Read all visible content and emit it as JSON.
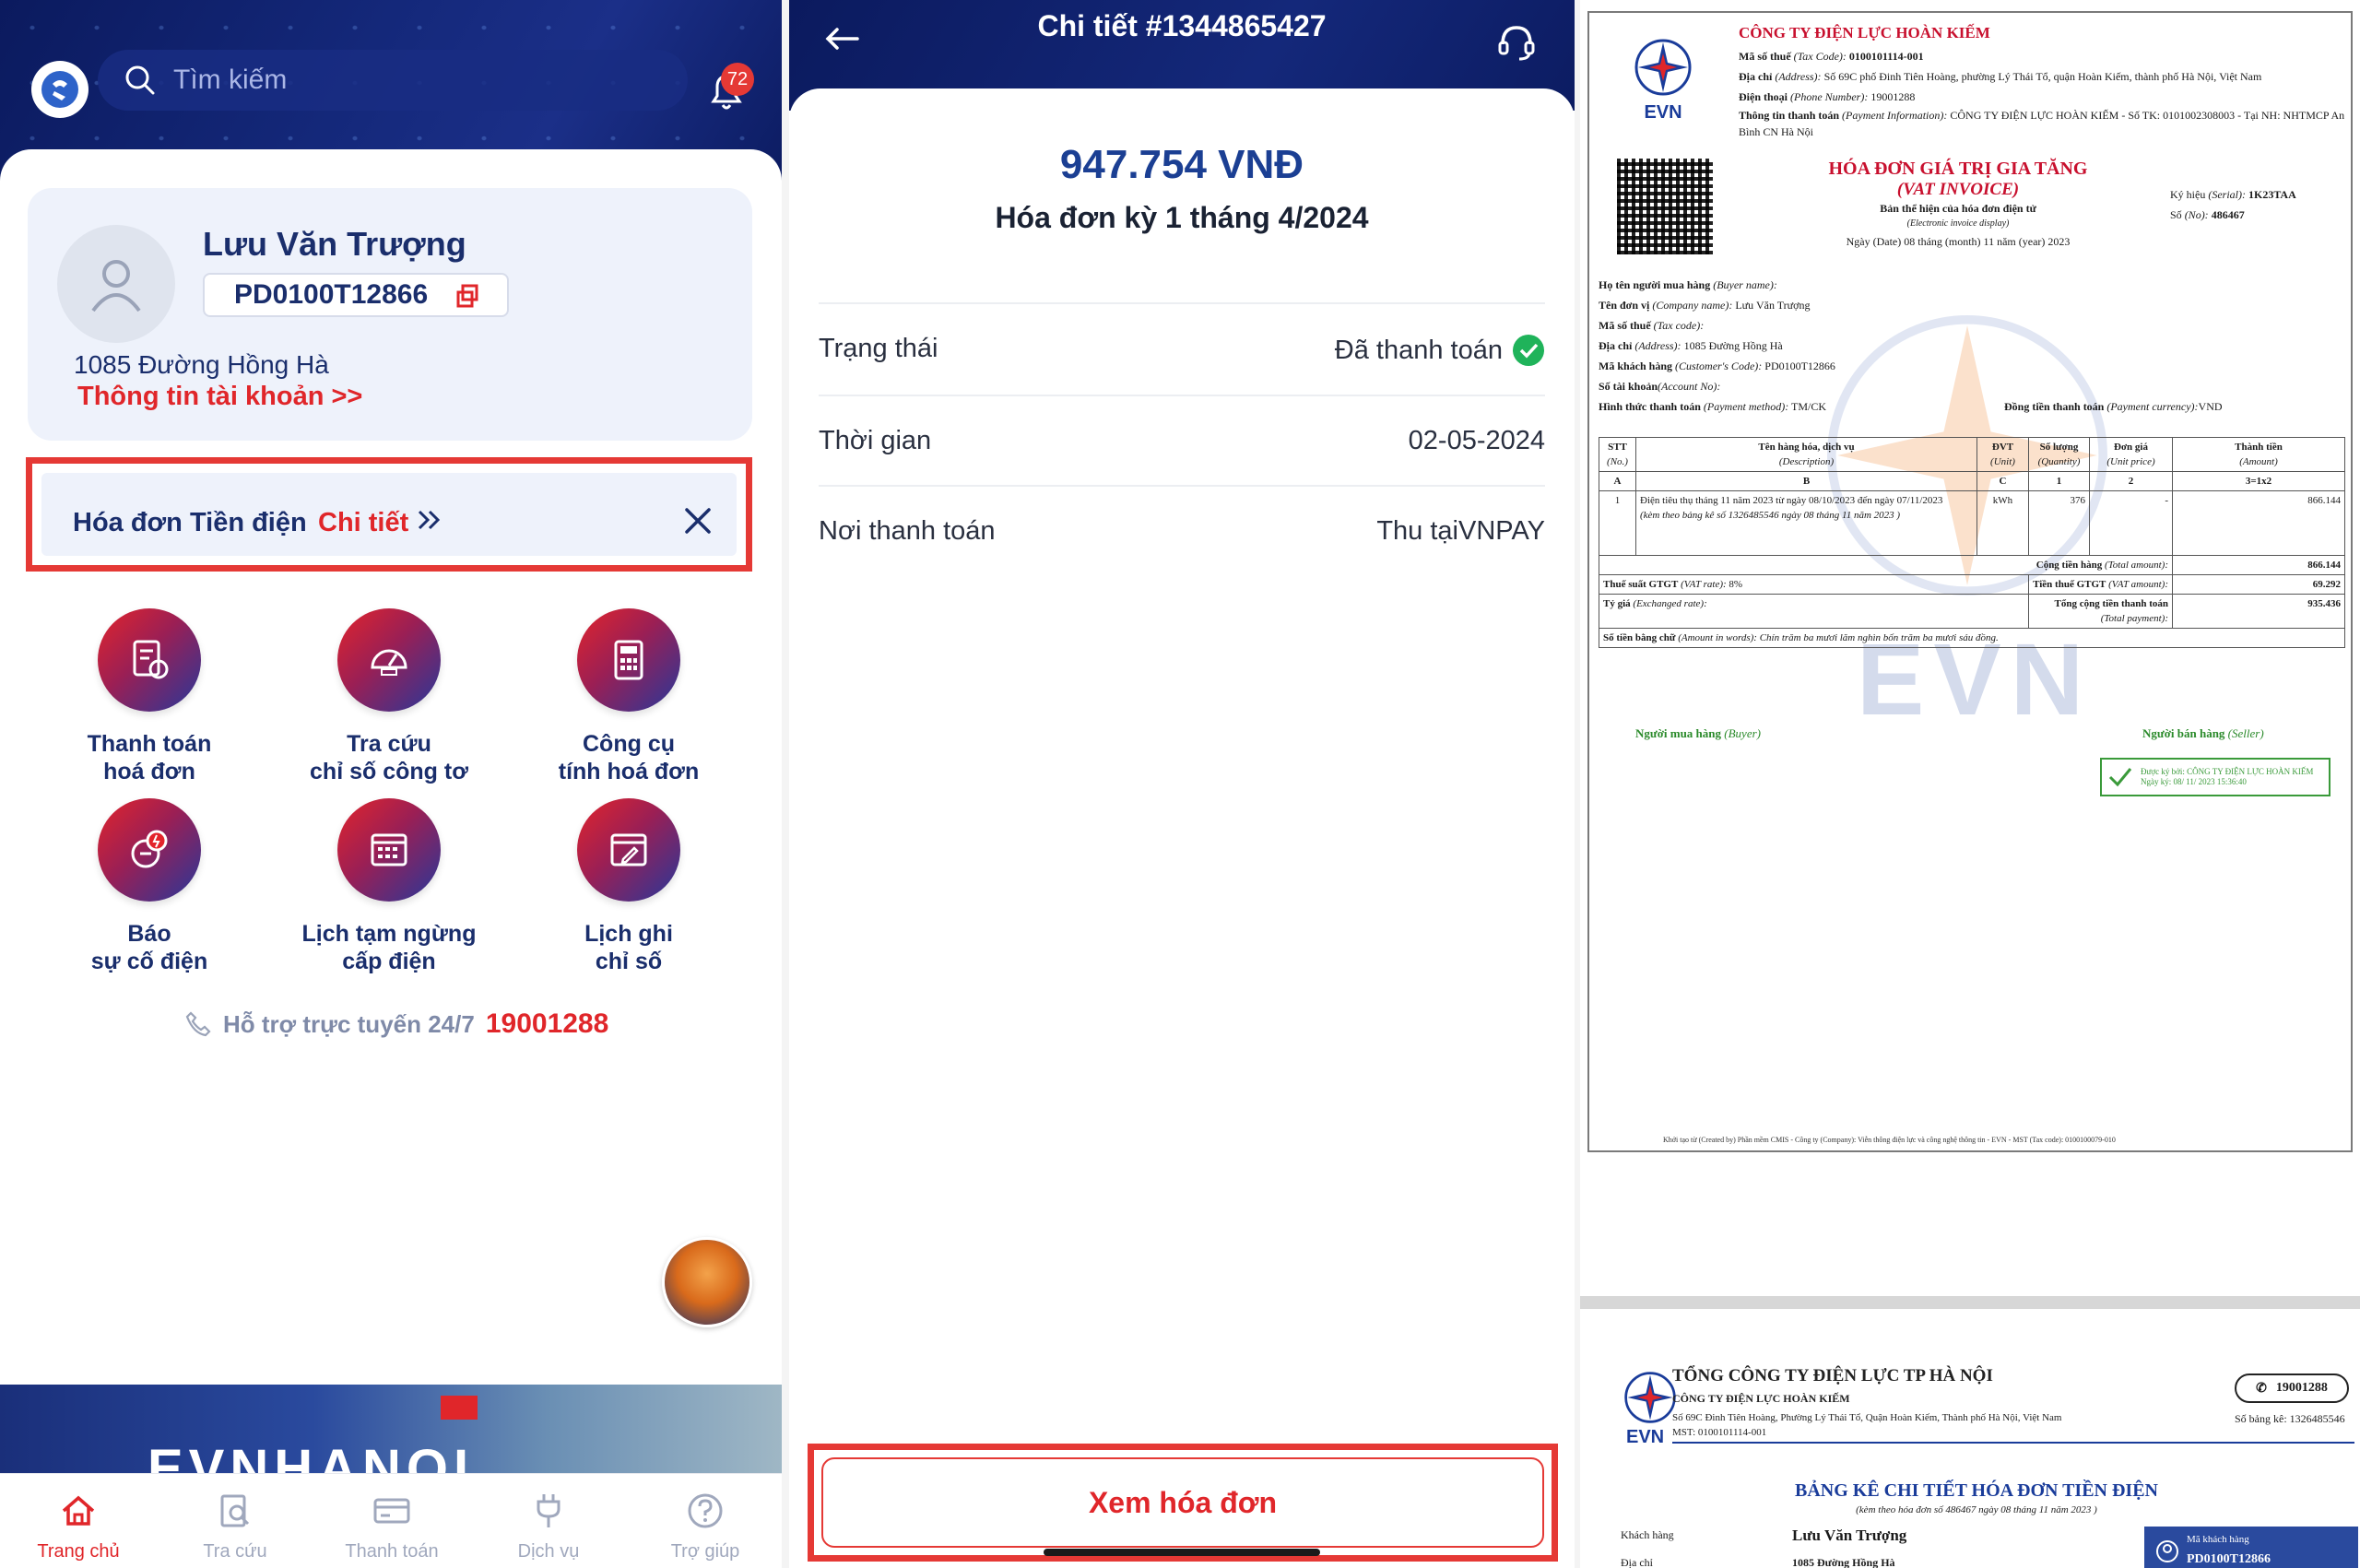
{
  "panel1": {
    "search_placeholder": "Tìm kiếm",
    "notif_count": "72",
    "account": {
      "name": "Lưu Văn Trượng",
      "customer_code": "PD0100T12866",
      "address": "1085 Đường Hồng Hà",
      "info_link": "Thông tin tài khoản >>"
    },
    "bill_banner": {
      "title": "Hóa đơn Tiền điện",
      "link": "Chi tiết"
    },
    "services": [
      {
        "line1": "Thanh toán",
        "line2": "hoá đơn",
        "icon": "invoice-pay-icon"
      },
      {
        "line1": "Tra cứu",
        "line2": "chỉ số công tơ",
        "icon": "meter-icon"
      },
      {
        "line1": "Công cụ",
        "line2": "tính hoá đơn",
        "icon": "calculator-icon"
      },
      {
        "line1": "Báo",
        "line2": "sự cố điện",
        "icon": "report-icon"
      },
      {
        "line1": "Lịch tạm ngừng",
        "line2": "cấp điện",
        "icon": "calendar-icon"
      },
      {
        "line1": "Lịch ghi",
        "line2": "chỉ số",
        "icon": "schedule-icon"
      }
    ],
    "hotline_label": "Hỗ trợ trực tuyến 24/7",
    "hotline_number": "19001288",
    "banner_text": "EVNHANOI",
    "tabs": [
      {
        "label": "Trang chủ",
        "icon": "home-icon"
      },
      {
        "label": "Tra cứu",
        "icon": "search-doc-icon"
      },
      {
        "label": "Thanh toán",
        "icon": "card-icon"
      },
      {
        "label": "Dịch vụ",
        "icon": "plug-icon"
      },
      {
        "label": "Trợ giúp",
        "icon": "help-icon"
      }
    ]
  },
  "panel2": {
    "title": "Chi tiết #1344865427",
    "amount": "947.754 VNĐ",
    "period": "Hóa đơn kỳ 1 tháng 4/2024",
    "rows": [
      {
        "key": "Trạng thái",
        "value": "Đã thanh toán"
      },
      {
        "key": "Thời gian",
        "value": "02-05-2024"
      },
      {
        "key": "Nơi thanh toán",
        "value": "Thu tạiVNPAY"
      }
    ],
    "button": "Xem hóa đơn"
  },
  "invoice": {
    "company": "CÔNG TY ĐIỆN LỰC HOÀN KIẾM",
    "tax_label": "Mã số thuế",
    "tax_label_en": "(Tax Code):",
    "tax_code": "0100101114-001",
    "address_label": "Địa chỉ",
    "address_label_en": "(Address):",
    "address": "Số 69C phố Đinh Tiên Hoàng, phường Lý Thái Tổ, quận Hoàn Kiếm, thành phố Hà Nội, Việt Nam",
    "phone_label": "Điện thoại",
    "phone_label_en": "(Phone Number):",
    "phone": "19001288",
    "payinfo_label": "Thông tin thanh toán",
    "payinfo_label_en": "(Payment Information):",
    "payinfo": "CÔNG TY ĐIỆN LỰC HOÀN KIẾM - Số TK: 0101002308003 - Tại NH: NHTMCP An Bình CN Hà Nội",
    "logo_text": "EVN",
    "title_vi": "HÓA ĐƠN GIÁ TRỊ GIA TĂNG",
    "title_en": "(VAT INVOICE)",
    "subtitle": "Bản thể hiện của hóa đơn điện tử",
    "subtitle_en": "(Electronic invoice display)",
    "date_line": "Ngày (Date) 08 tháng (month) 11 năm (year) 2023",
    "serial_label": "Ký hiệu",
    "serial_label_en": "(Serial):",
    "serial": "1K23TAA",
    "no_label": "Số",
    "no_label_en": "(No):",
    "no": "486467",
    "buyer": [
      {
        "k": "Họ tên người mua hàng",
        "ken": "(Buyer name):",
        "v": ""
      },
      {
        "k": "Tên đơn vị",
        "ken": "(Company name):",
        "v": "Lưu Văn Trượng"
      },
      {
        "k": "Mã số thuế",
        "ken": "(Tax code):",
        "v": ""
      },
      {
        "k": "Địa chỉ",
        "ken": "(Address):",
        "v": "1085 Đường Hồng Hà"
      },
      {
        "k": "Mã khách hàng",
        "ken": "(Customer's Code):",
        "v": "PD0100T12866"
      },
      {
        "k": "Số tài khoản",
        "ken": "(Account No):",
        "v": ""
      }
    ],
    "payment_method_label": "Hình thức thanh toán",
    "payment_method_label_en": "(Payment method):",
    "payment_method": "TM/CK",
    "currency_label": "Đồng tiền thanh toán",
    "currency_label_en": "(Payment currency):",
    "currency": "VND",
    "headers": [
      {
        "vi": "STT",
        "en": "(No.)"
      },
      {
        "vi": "Tên hàng hóa, dịch vụ",
        "en": "(Description)"
      },
      {
        "vi": "ĐVT",
        "en": "(Unit)"
      },
      {
        "vi": "Số lượng",
        "en": "(Quantity)"
      },
      {
        "vi": "Đơn giá",
        "en": "(Unit price)"
      },
      {
        "vi": "Thành tiền",
        "en": "(Amount)"
      }
    ],
    "letters": [
      "A",
      "B",
      "C",
      "1",
      "2",
      "3=1x2"
    ],
    "item": {
      "no": "1",
      "desc": "Điện tiêu thụ tháng 11 năm 2023 từ ngày 08/10/2023 đến ngày 07/11/2023",
      "note": "(kèm theo bảng kê số 1326485546 ngày 08 tháng 11 năm 2023 )",
      "unit": "kWh",
      "qty": "376",
      "price": "-",
      "amount": "866.144"
    },
    "total_label": "Cộng tiền hàng",
    "total_label_en": "(Total amount):",
    "total": "866.144",
    "vat_rate_label": "Thuế suất GTGT",
    "vat_rate_label_en": "(VAT rate):",
    "vat_rate": "8%",
    "vat_amount_label": "Tiền thuế GTGT",
    "vat_amount_label_en": "(VAT amount):",
    "vat_amount": "69.292",
    "exchange_label": "Tỷ giá",
    "exchange_label_en": "(Exchanged rate):",
    "grand_label": "Tổng cộng tiền thanh toán",
    "grand_label_en": "(Total payment):",
    "grand": "935.436",
    "words_label": "Số tiền bằng chữ",
    "words_label_en": "(Amount in words):",
    "words": "Chín trăm ba mươi lăm nghìn bốn trăm ba mươi sáu đồng.",
    "buyer_sign": "Người mua hàng",
    "buyer_sign_en": "(Buyer)",
    "seller_sign": "Người bán hàng",
    "seller_sign_en": "(Seller)",
    "stamp_line1": "Được ký bởi: CÔNG TY ĐIỆN LỰC HOÀN KIẾM",
    "stamp_line2": "Ngày ký: 08/ 11/ 2023   15:36:40",
    "footer": "Khởi tạo từ (Created by) Phần mềm CMIS - Công ty (Company): Viễn thông điện lực và công nghệ thông tin - EVN - MST (Tax code): 0100100079-010"
  },
  "invoice2": {
    "corp": "TỔNG CÔNG TY ĐIỆN LỰC TP HÀ NỘI",
    "sub": "CÔNG TY ĐIỆN LỰC HOÀN KIẾM",
    "addr": "Số 69C Đinh Tiên Hoàng, Phường Lý Thái Tổ, Quận Hoàn Kiếm, Thành phố Hà Nội, Việt Nam",
    "mst": "MST: 0100101114-001",
    "phone": "19001288",
    "bk_label": "Số bảng kê:",
    "bk": "1326485546",
    "logo_text": "EVN",
    "title": "BẢNG KÊ CHI TIẾT HÓA ĐƠN TIỀN ĐIỆN",
    "subtitle": "(kèm theo hóa đơn số 486467 ngày 08 tháng 11 năm 2023 )",
    "kh_label": "Khách hàng",
    "kh_value": "Lưu Văn Trượng",
    "dc_label": "Địa chỉ",
    "dc_value": "1085 Đường Hồng Hà",
    "mk_label": "Mã khách hàng",
    "mk_value": "PD0100T12866"
  }
}
